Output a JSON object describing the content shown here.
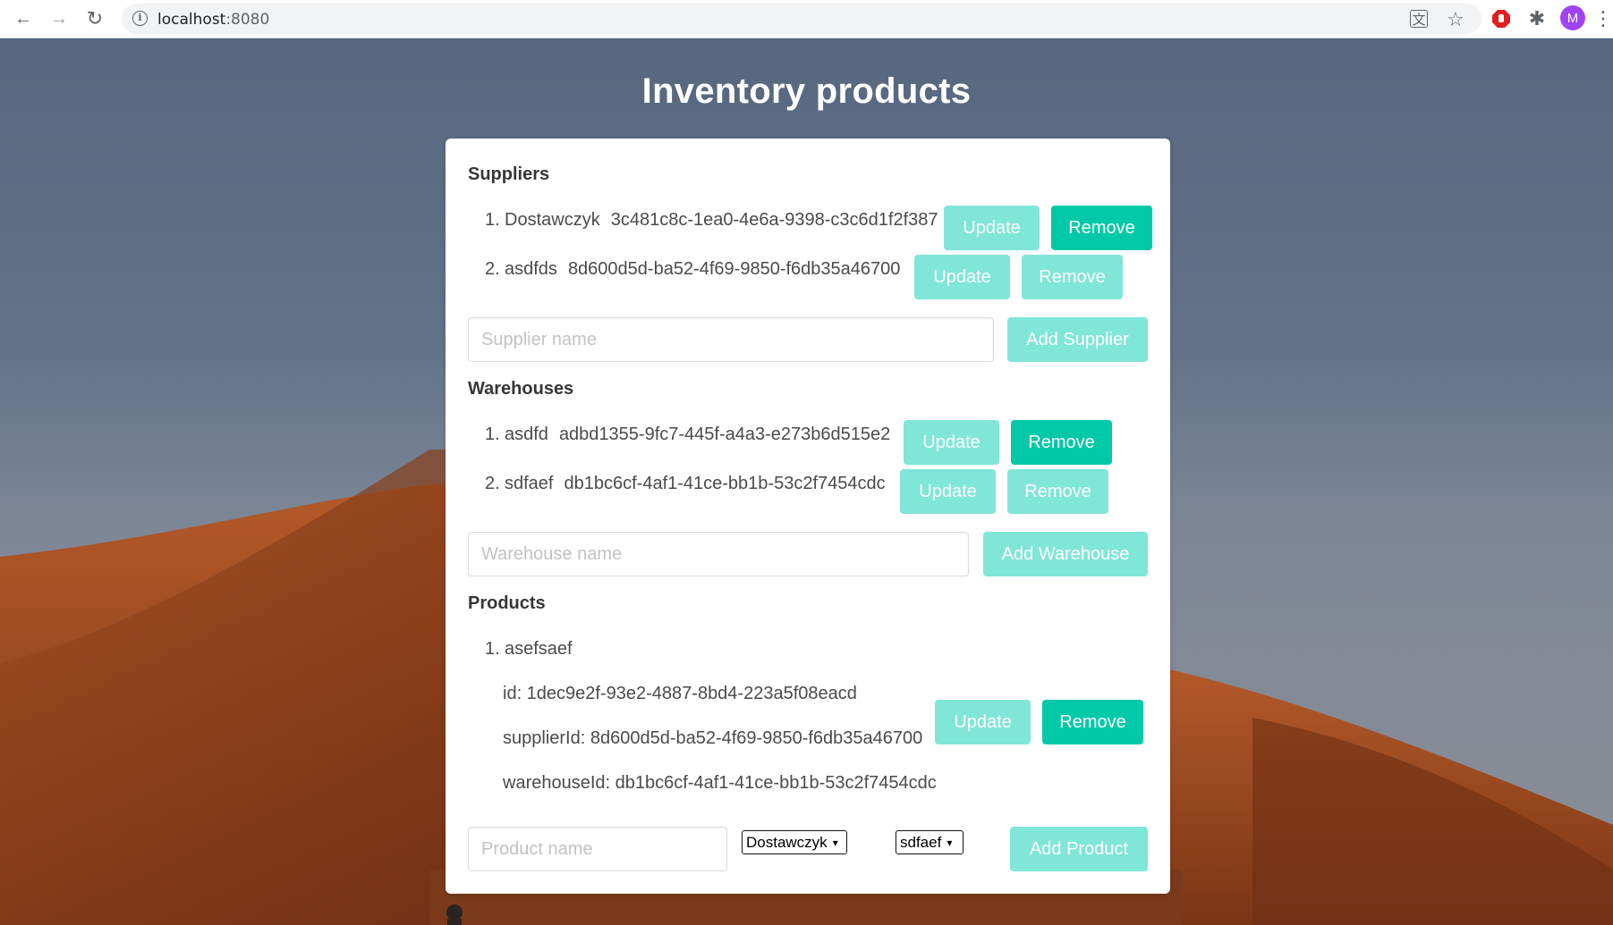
{
  "browser": {
    "url_host": "localhost",
    "url_port": ":8080",
    "avatar_letter": "M",
    "icons": {
      "back": "←",
      "forward": "→",
      "reload": "↻",
      "translate": "文",
      "star": "☆",
      "extension": "✱",
      "menu": "⋮"
    }
  },
  "page": {
    "title": "Inventory products"
  },
  "suppliers": {
    "heading": "Suppliers",
    "items": [
      {
        "num": "1.",
        "name": "Dostawczyk",
        "id": "3c481c8c-1ea0-4e6a-9398-c3c6d1f2f387"
      },
      {
        "num": "2.",
        "name": "asdfds",
        "id": "8d600d5d-ba52-4f69-9850-f6db35a46700"
      }
    ],
    "input_placeholder": "Supplier name",
    "add_label": "Add Supplier"
  },
  "warehouses": {
    "heading": "Warehouses",
    "items": [
      {
        "num": "1.",
        "name": "asdfd",
        "id": "adbd1355-9fc7-445f-a4a3-e273b6d515e2"
      },
      {
        "num": "2.",
        "name": "sdfaef",
        "id": "db1bc6cf-4af1-41ce-bb1b-53c2f7454cdc"
      }
    ],
    "input_placeholder": "Warehouse name",
    "add_label": "Add Warehouse"
  },
  "products": {
    "heading": "Products",
    "items": [
      {
        "num": "1.",
        "name": "asefsaef",
        "id_line": "id: 1dec9e2f-93e2-4887-8bd4-223a5f08eacd",
        "supplier_line": "supplierId: 8d600d5d-ba52-4f69-9850-f6db35a46700",
        "warehouse_line": "warehouseId: db1bc6cf-4af1-41ce-bb1b-53c2f7454cdc"
      }
    ],
    "input_placeholder": "Product name",
    "supplier_select": "Dostawczyk",
    "warehouse_select": "sdfaef",
    "add_label": "Add Product"
  },
  "buttons": {
    "update": "Update",
    "remove": "Remove"
  },
  "colors": {
    "button_light": "#80e6d8",
    "button_dark": "#00c9a7",
    "avatar": "#a142f4"
  }
}
